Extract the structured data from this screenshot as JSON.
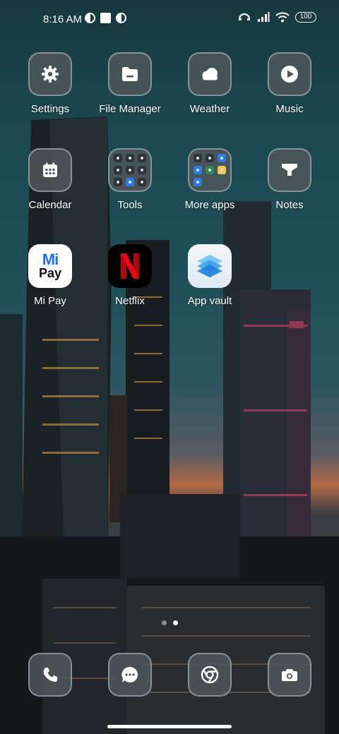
{
  "status_bar": {
    "time": "8:16 AM",
    "battery": "100",
    "icons_left": [
      "notification-app-icon",
      "square-notification-icon",
      "notification-app-icon"
    ],
    "icons_right": [
      "hotspot-icon",
      "signal-icon",
      "wifi-icon",
      "battery-icon"
    ]
  },
  "apps": [
    {
      "label": "Settings",
      "icon": "gear-icon"
    },
    {
      "label": "File Manager",
      "icon": "folder-icon"
    },
    {
      "label": "Weather",
      "icon": "cloud-icon"
    },
    {
      "label": "Music",
      "icon": "play-icon"
    },
    {
      "label": "Calendar",
      "icon": "calendar-icon"
    },
    {
      "label": "Tools",
      "icon": "tools-folder-icon"
    },
    {
      "label": "More apps",
      "icon": "apps-folder-icon"
    },
    {
      "label": "Notes",
      "icon": "notes-icon"
    },
    {
      "label": "Mi Pay",
      "icon": "mi-pay-logo",
      "logo_top": "Mi",
      "logo_bottom": "Pay"
    },
    {
      "label": "Netflix",
      "icon": "netflix-logo",
      "logo": "N"
    },
    {
      "label": "App vault",
      "icon": "app-vault-icon"
    }
  ],
  "page_indicator": {
    "pages": 2,
    "current": 2
  },
  "dock": [
    {
      "name": "phone",
      "icon": "phone-icon"
    },
    {
      "name": "messages",
      "icon": "message-icon"
    },
    {
      "name": "chrome",
      "icon": "chrome-icon"
    },
    {
      "name": "camera",
      "icon": "camera-icon"
    }
  ],
  "colors": {
    "icon_background": "#50585c",
    "netflix_red": "#e50914",
    "mipay_blue": "#1e73e8"
  }
}
